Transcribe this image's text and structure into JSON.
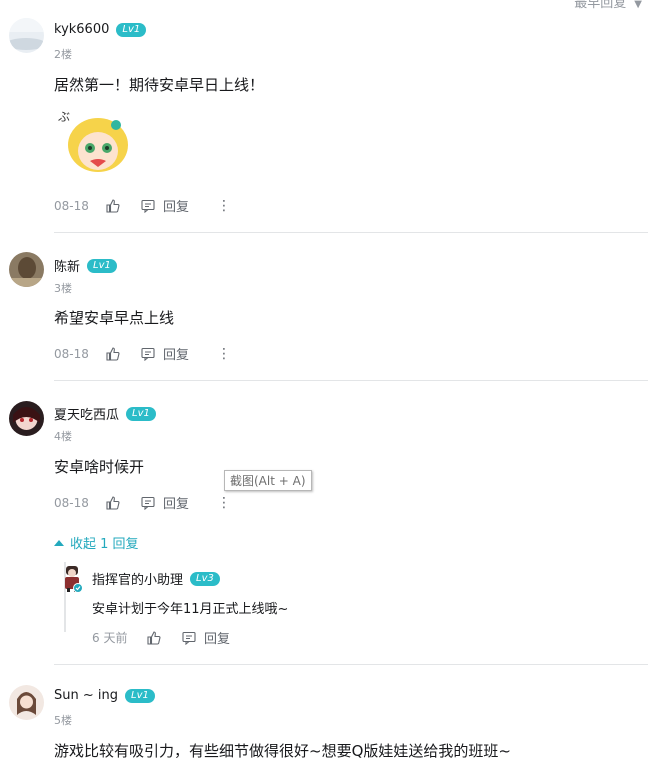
{
  "sort_label": "最早回复",
  "comments": [
    {
      "username": "kyk6600",
      "level": "Lv1",
      "floor": "2楼",
      "text": "居然第一！期待安卓早日上线！",
      "date": "08-18",
      "reply_label": "回复",
      "sticker_text": "ぶ"
    },
    {
      "username": "陈新",
      "level": "Lv1",
      "floor": "3楼",
      "text": "希望安卓早点上线",
      "date": "08-18",
      "reply_label": "回复"
    },
    {
      "username": "夏天吃西瓜",
      "level": "Lv1",
      "floor": "4楼",
      "text": "安卓啥时候开",
      "date": "08-18",
      "reply_label": "回复"
    },
    {
      "username": "Sun ~ ing",
      "level": "Lv1",
      "floor": "5楼",
      "text": "游戏比较有吸引力，有些细节做得很好~想要Q版娃娃送给我的班班~"
    }
  ],
  "tooltip": "截图(Alt + A)",
  "collapse_label": "收起 1 回复",
  "sub_reply": {
    "username": "指挥官的小助理",
    "level": "Lv3",
    "text": "安卓计划于今年11月正式上线哦~",
    "date": "6 天前",
    "reply_label": "回复"
  },
  "colors": {
    "accent": "#23a9bd",
    "level_badge": "#2bbcc8",
    "muted": "#9499a0"
  }
}
